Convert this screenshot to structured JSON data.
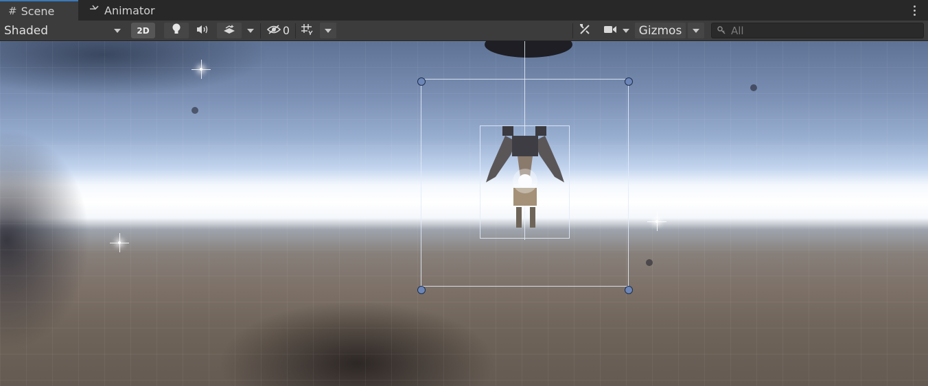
{
  "tabs": [
    {
      "label": "Scene",
      "icon": "grid-icon",
      "active": true
    },
    {
      "label": "Animator",
      "icon": "animator-icon",
      "active": false
    }
  ],
  "toolbar": {
    "draw_mode": "Shaded",
    "mode_2d": "2D",
    "hidden_count": "0",
    "gizmos": "Gizmos",
    "search_placeholder": "All"
  },
  "colors": {
    "active_tab_accent": "#3a79bb",
    "handle": "#6d86b8",
    "selection_outline": "#e1ebfa"
  }
}
